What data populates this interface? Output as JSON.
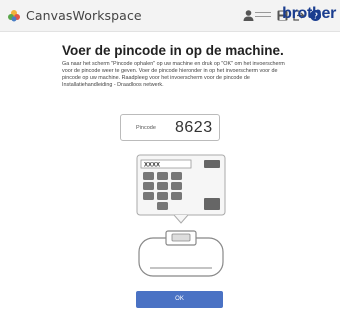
{
  "header": {
    "app_title": "CanvasWorkspace",
    "brand": "brother",
    "icons": [
      "user-icon",
      "save-icon",
      "logout-icon",
      "help-icon"
    ]
  },
  "page": {
    "title": "Voer de pincode in op de machine.",
    "instructions": "Ga naar het scherm \"Pincode ophalen\" op uw machine en druk op \"OK\" om het invoerscherm voor de pincode weer te geven. Voer de pincode hieronder in op het invoerscherm voor de pincode op uw machine. Raadpleeg voor het invoerscherm voor de pincode de Installatiehandleiding - Draadloos netwerk."
  },
  "pin": {
    "label": "Pincode",
    "value": "8623"
  },
  "illustration": {
    "screen_text": "XXXX"
  },
  "ok_button": {
    "label": "OK"
  },
  "colors": {
    "brand": "#1a3d8f",
    "button": "#4a72c4",
    "header_bg": "#f3f3f3"
  }
}
